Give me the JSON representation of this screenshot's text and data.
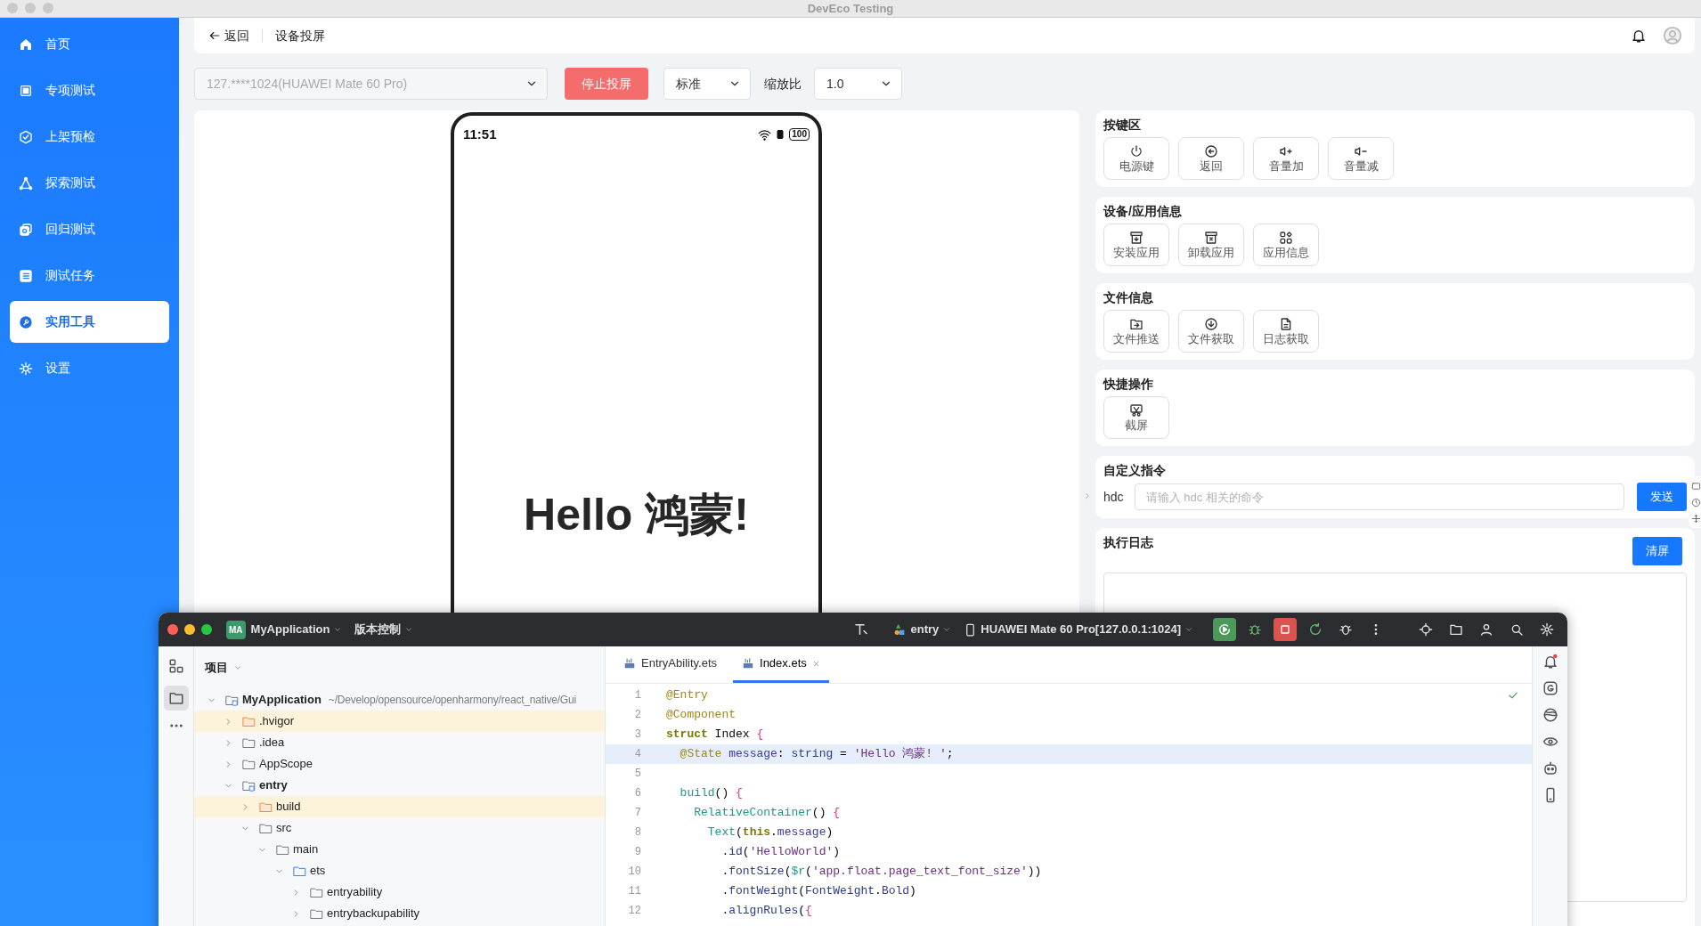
{
  "window": {
    "title": "DevEco Testing"
  },
  "sidebar": {
    "items": [
      {
        "label": "首页",
        "selected": false
      },
      {
        "label": "专项测试",
        "selected": false
      },
      {
        "label": "上架预检",
        "selected": false
      },
      {
        "label": "探索测试",
        "selected": false
      },
      {
        "label": "回归测试",
        "selected": false
      },
      {
        "label": "测试任务",
        "selected": false
      },
      {
        "label": "实用工具",
        "selected": true
      },
      {
        "label": "设置",
        "selected": false
      }
    ]
  },
  "header": {
    "back": "返回",
    "title": "设备投屏"
  },
  "toolbar": {
    "device": {
      "value": "127.****1024(HUAWEI Mate 60 Pro)",
      "disabled": true
    },
    "stop": "停止投屏",
    "quality": "标准",
    "zoom_label": "缩放比",
    "zoom": "1.0"
  },
  "device_screen": {
    "time": "11:51",
    "battery": "100",
    "text": "Hello 鸿蒙!"
  },
  "panels": [
    {
      "title": "按键区",
      "buttons": [
        "电源键",
        "返回",
        "音量加",
        "音量减"
      ]
    },
    {
      "title": "设备/应用信息",
      "buttons": [
        "安装应用",
        "卸载应用",
        "应用信息"
      ]
    },
    {
      "title": "文件信息",
      "buttons": [
        "文件推送",
        "文件获取",
        "日志获取"
      ]
    },
    {
      "title": "快捷操作",
      "buttons": [
        "截屏"
      ]
    }
  ],
  "command": {
    "title": "自定义指令",
    "prefix": "hdc",
    "placeholder": "请输入 hdc 相关的命令",
    "send": "发送"
  },
  "log": {
    "title": "执行日志",
    "clear": "清屏"
  },
  "ide": {
    "badge": "MA",
    "project": "MyApplication",
    "vcs": "版本控制",
    "run_config": "entry",
    "device": "HUAWEI Mate 60 Pro[127.0.0.1:1024]",
    "tool_windows": [
      {
        "selected": false
      },
      {
        "selected": true
      }
    ],
    "pane_title": "项目",
    "tree": [
      {
        "label": "MyApplication",
        "path": "~/Develop/opensource/openharmony/react_native/Gui",
        "kind": "module",
        "expanded": true,
        "children": [
          {
            "label": ".hvigor",
            "kind": "excluded",
            "expanded": false
          },
          {
            "label": ".idea",
            "kind": "folder",
            "expanded": false
          },
          {
            "label": "AppScope",
            "kind": "folder",
            "expanded": false
          },
          {
            "label": "entry",
            "kind": "module",
            "expanded": true,
            "children": [
              {
                "label": "build",
                "kind": "excluded",
                "expanded": false
              },
              {
                "label": "src",
                "kind": "folder",
                "expanded": true,
                "children": [
                  {
                    "label": "main",
                    "kind": "folder",
                    "expanded": true,
                    "children": [
                      {
                        "label": "ets",
                        "kind": "source",
                        "expanded": true,
                        "children": [
                          {
                            "label": "entryability",
                            "kind": "folder",
                            "expanded": false
                          },
                          {
                            "label": "entrybackupability",
                            "kind": "folder",
                            "expanded": false
                          }
                        ]
                      }
                    ]
                  }
                ]
              }
            ]
          }
        ]
      }
    ],
    "tabs": [
      {
        "label": "EntryAbility.ets",
        "selected": false
      },
      {
        "label": "Index.ets",
        "selected": true
      }
    ],
    "code": [
      {
        "number": "1",
        "current": false,
        "tokens": [
          {
            "text": "@Entry",
            "kind": "annotation"
          }
        ]
      },
      {
        "number": "2",
        "current": false,
        "tokens": [
          {
            "text": "@Component",
            "kind": "annotation"
          }
        ]
      },
      {
        "number": "3",
        "current": false,
        "tokens": [
          {
            "text": "struct",
            "kind": "keyword"
          },
          {
            "text": " Index ",
            "kind": "plain"
          },
          {
            "text": "{",
            "kind": "brace"
          }
        ]
      },
      {
        "number": "4",
        "current": true,
        "tokens": [
          {
            "text": "  @State",
            "kind": "annotation"
          },
          {
            "text": " message",
            "kind": "prop"
          },
          {
            "text": ": ",
            "kind": "plain"
          },
          {
            "text": "string",
            "kind": "type"
          },
          {
            "text": " = ",
            "kind": "plain"
          },
          {
            "text": "'Hello 鸿蒙! '",
            "kind": "string"
          },
          {
            "text": ";",
            "kind": "plain"
          }
        ]
      },
      {
        "number": "5",
        "current": false
      },
      {
        "number": "6",
        "current": false,
        "tokens": [
          {
            "text": "  build",
            "kind": "func"
          },
          {
            "text": "() ",
            "kind": "plain"
          },
          {
            "text": "{",
            "kind": "brace"
          }
        ]
      },
      {
        "number": "7",
        "current": false,
        "tokens": [
          {
            "text": "    RelativeContainer",
            "kind": "func"
          },
          {
            "text": "() ",
            "kind": "plain"
          },
          {
            "text": "{",
            "kind": "brace"
          }
        ]
      },
      {
        "number": "8",
        "current": false,
        "tokens": [
          {
            "text": "      Text",
            "kind": "func"
          },
          {
            "text": "(",
            "kind": "plain"
          },
          {
            "text": "this",
            "kind": "keyword"
          },
          {
            "text": ".",
            "kind": "plain"
          },
          {
            "text": "message",
            "kind": "prop"
          },
          {
            "text": ")",
            "kind": "plain"
          }
        ]
      },
      {
        "number": "9",
        "current": false,
        "tokens": [
          {
            "text": "        .",
            "kind": "plain"
          },
          {
            "text": "id",
            "kind": "method"
          },
          {
            "text": "(",
            "kind": "plain"
          },
          {
            "text": "'HelloWorld'",
            "kind": "string"
          },
          {
            "text": ")",
            "kind": "plain"
          }
        ]
      },
      {
        "number": "10",
        "current": false,
        "tokens": [
          {
            "text": "        .",
            "kind": "plain"
          },
          {
            "text": "fontSize",
            "kind": "method"
          },
          {
            "text": "(",
            "kind": "plain"
          },
          {
            "text": "$r",
            "kind": "func"
          },
          {
            "text": "(",
            "kind": "plain"
          },
          {
            "text": "'app.float.page_text_font_size'",
            "kind": "string"
          },
          {
            "text": "))",
            "kind": "plain"
          }
        ]
      },
      {
        "number": "11",
        "current": false,
        "tokens": [
          {
            "text": "        .",
            "kind": "plain"
          },
          {
            "text": "fontWeight",
            "kind": "method"
          },
          {
            "text": "(",
            "kind": "plain"
          },
          {
            "text": "FontWeight",
            "kind": "type"
          },
          {
            "text": ".",
            "kind": "plain"
          },
          {
            "text": "Bold",
            "kind": "prop"
          },
          {
            "text": ")",
            "kind": "plain"
          }
        ]
      },
      {
        "number": "12",
        "current": false,
        "tokens": [
          {
            "text": "        .",
            "kind": "plain"
          },
          {
            "text": "alignRules",
            "kind": "method"
          },
          {
            "text": "(",
            "kind": "plain"
          },
          {
            "text": "{",
            "kind": "brace"
          }
        ]
      }
    ]
  }
}
